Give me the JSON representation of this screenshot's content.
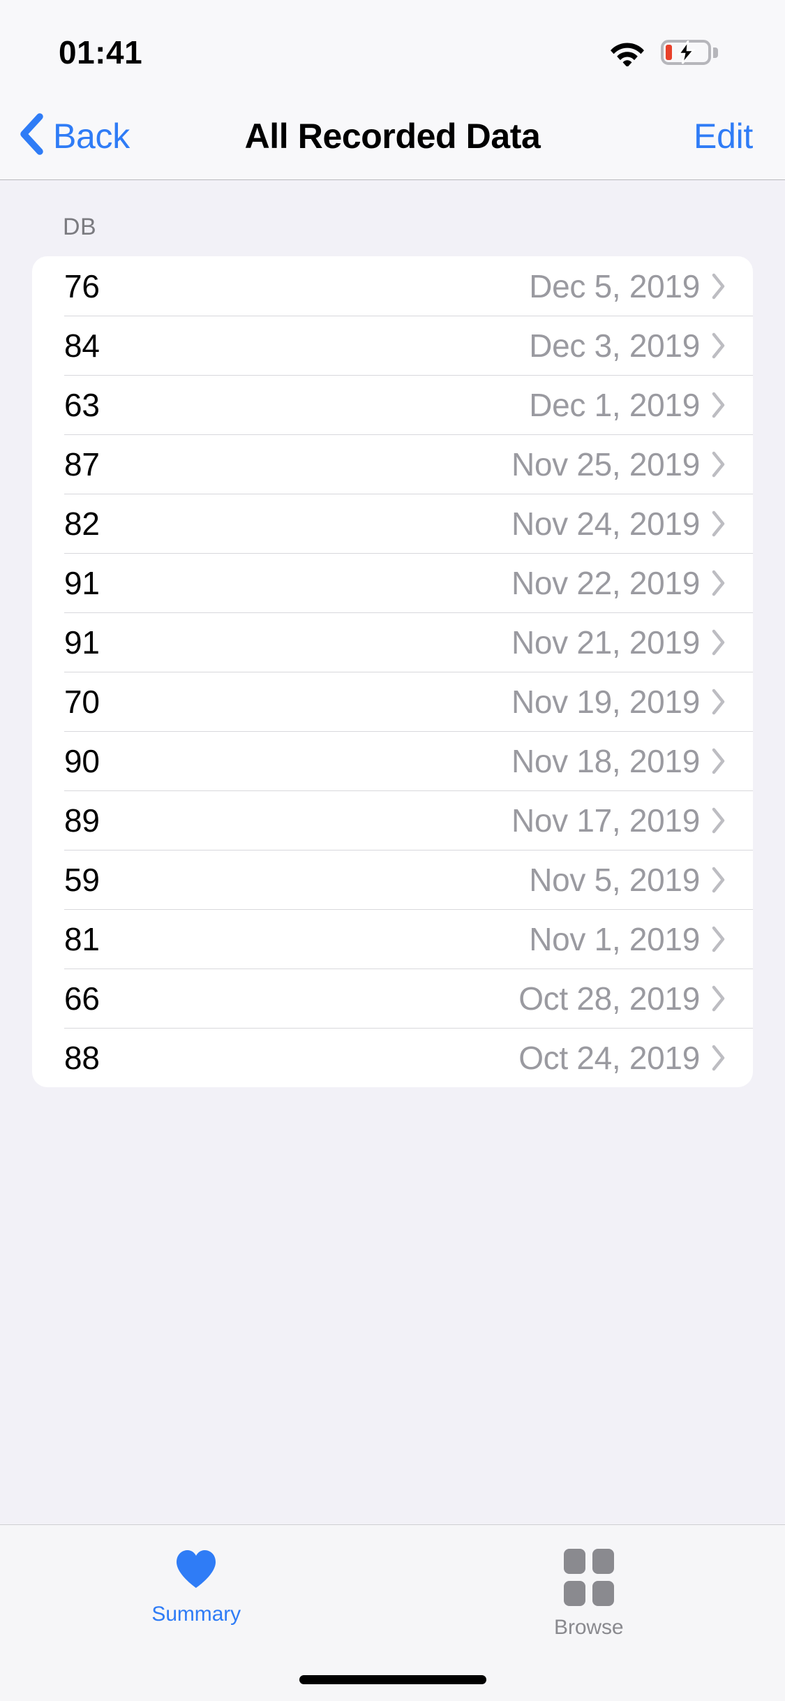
{
  "status_bar": {
    "time": "01:41",
    "wifi_icon": "wifi-icon",
    "battery_icon": "battery-charging-icon"
  },
  "nav_bar": {
    "back_label": "Back",
    "back_icon": "chevron-left-icon",
    "title": "All Recorded Data",
    "edit_label": "Edit"
  },
  "content": {
    "section_header": "DB",
    "rows": [
      {
        "value": "76",
        "date": "Dec 5, 2019"
      },
      {
        "value": "84",
        "date": "Dec 3, 2019"
      },
      {
        "value": "63",
        "date": "Dec 1, 2019"
      },
      {
        "value": "87",
        "date": "Nov 25, 2019"
      },
      {
        "value": "82",
        "date": "Nov 24, 2019"
      },
      {
        "value": "91",
        "date": "Nov 22, 2019"
      },
      {
        "value": "91",
        "date": "Nov 21, 2019"
      },
      {
        "value": "70",
        "date": "Nov 19, 2019"
      },
      {
        "value": "90",
        "date": "Nov 18, 2019"
      },
      {
        "value": "89",
        "date": "Nov 17, 2019"
      },
      {
        "value": "59",
        "date": "Nov 5, 2019"
      },
      {
        "value": "81",
        "date": "Nov 1, 2019"
      },
      {
        "value": "66",
        "date": "Oct 28, 2019"
      },
      {
        "value": "88",
        "date": "Oct 24, 2019"
      }
    ],
    "disclosure_icon": "chevron-right-icon"
  },
  "tab_bar": {
    "tabs": [
      {
        "label": "Summary",
        "icon": "heart-icon",
        "active": true
      },
      {
        "label": "Browse",
        "icon": "grid-icon",
        "active": false
      }
    ]
  },
  "colors": {
    "accent_blue": "#2F7CF6",
    "background": "#F2F1F7",
    "card": "#FFFFFF",
    "secondary_text": "#9A9AA0",
    "battery_low": "#E8402A"
  }
}
